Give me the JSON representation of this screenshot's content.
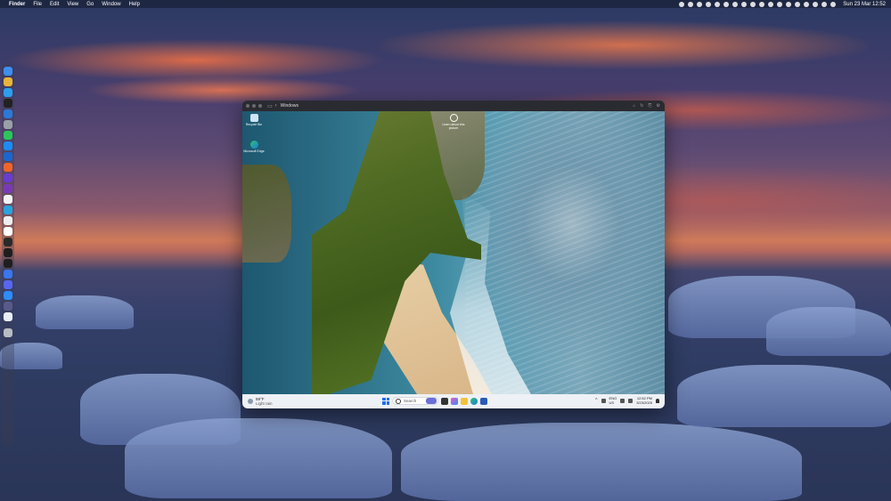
{
  "menubar": {
    "app": "Finder",
    "menus": [
      "File",
      "Edit",
      "View",
      "Go",
      "Window",
      "Help"
    ],
    "clock": "Sun 23 Mar  12:52"
  },
  "dock": {
    "apps": [
      "finder",
      "chrome",
      "safari",
      "terminal",
      "vscode",
      "settings",
      "whatsapp",
      "app-store",
      "onepassword",
      "brave",
      "affinity",
      "tor",
      "notion",
      "telegram",
      "capcut",
      "chatgpt",
      "obsidian",
      "figma",
      "hidden-bar",
      "signal",
      "discord",
      "zoom",
      "calculator",
      "preview",
      "trash"
    ]
  },
  "window": {
    "title": "Windows",
    "desktop_icons": [
      {
        "label": "Recycle Bin",
        "icon": "recycle-bin-icon"
      },
      {
        "label": "Microsoft Edge",
        "icon": "edge-icon"
      },
      {
        "label": "Learn about this picture",
        "icon": "camera-icon"
      }
    ],
    "taskbar": {
      "weather_temp": "59°F",
      "weather_cond": "Light rain",
      "search_placeholder": "Search",
      "lang_top": "ENG",
      "lang_bottom": "US",
      "time": "12:52 PM",
      "date": "3/23/2025"
    }
  }
}
